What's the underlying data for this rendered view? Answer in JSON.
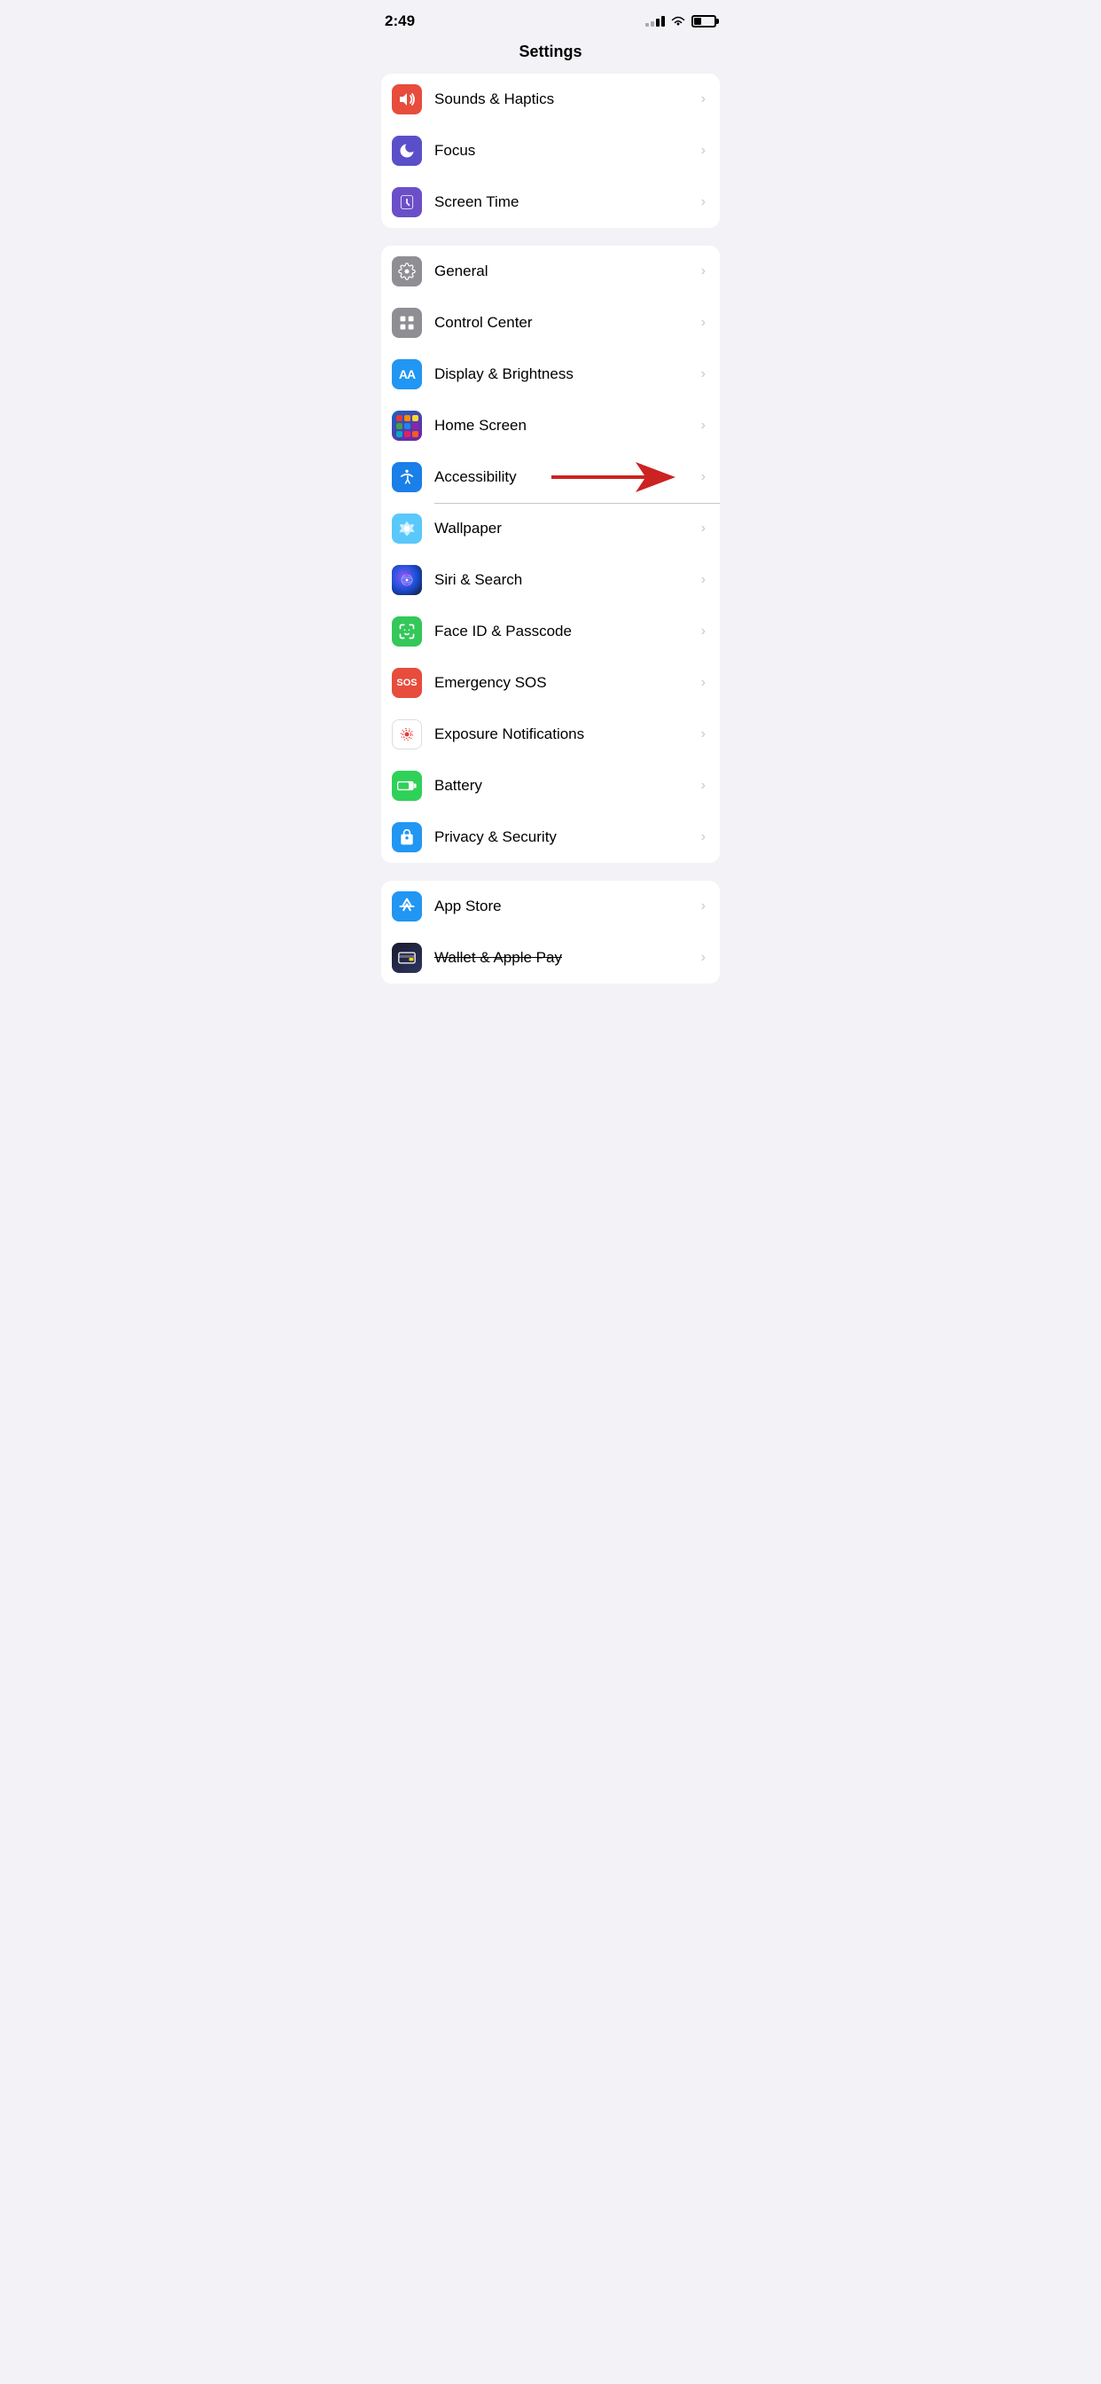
{
  "statusBar": {
    "time": "2:49"
  },
  "pageTitle": "Settings",
  "groups": [
    {
      "id": "group1",
      "items": [
        {
          "id": "sounds-haptics",
          "label": "Sounds & Haptics",
          "iconBg": "icon-red",
          "iconSymbol": "🔊"
        },
        {
          "id": "focus",
          "label": "Focus",
          "iconBg": "icon-purple",
          "iconSymbol": "🌙"
        },
        {
          "id": "screen-time",
          "label": "Screen Time",
          "iconBg": "icon-purple-dark",
          "iconSymbol": "⏱"
        }
      ]
    },
    {
      "id": "group2",
      "items": [
        {
          "id": "general",
          "label": "General",
          "iconBg": "icon-gray",
          "iconSymbol": "⚙️"
        },
        {
          "id": "control-center",
          "label": "Control Center",
          "iconBg": "icon-gray",
          "iconSymbol": "⊙"
        },
        {
          "id": "display-brightness",
          "label": "Display & Brightness",
          "iconBg": "icon-blue",
          "iconSymbol": "AA"
        },
        {
          "id": "home-screen",
          "label": "Home Screen",
          "iconBg": "icon-multicolor",
          "iconSymbol": "⠿"
        },
        {
          "id": "accessibility",
          "label": "Accessibility",
          "iconBg": "icon-blue-dark",
          "iconSymbol": "♿",
          "hasArrow": true
        },
        {
          "id": "wallpaper",
          "label": "Wallpaper",
          "iconBg": "icon-teal",
          "iconSymbol": "✿"
        },
        {
          "id": "siri-search",
          "label": "Siri & Search",
          "iconBg": "icon-siri",
          "iconSymbol": "◉"
        },
        {
          "id": "face-id",
          "label": "Face ID & Passcode",
          "iconBg": "icon-green",
          "iconSymbol": "☺"
        },
        {
          "id": "emergency-sos",
          "label": "Emergency SOS",
          "iconBg": "icon-orange-red",
          "iconSymbol": "SOS"
        },
        {
          "id": "exposure",
          "label": "Exposure Notifications",
          "iconBg": "icon-exposure",
          "iconSymbol": "◎"
        },
        {
          "id": "battery",
          "label": "Battery",
          "iconBg": "icon-battery-green",
          "iconSymbol": "▬"
        },
        {
          "id": "privacy",
          "label": "Privacy & Security",
          "iconBg": "icon-privacy",
          "iconSymbol": "✋"
        }
      ]
    },
    {
      "id": "group3",
      "items": [
        {
          "id": "app-store",
          "label": "App Store",
          "iconBg": "icon-appstore",
          "iconSymbol": "A"
        },
        {
          "id": "wallet",
          "label": "Wallet & Apple Pay",
          "iconBg": "icon-wallet",
          "iconSymbol": "💳",
          "strikethrough": true
        }
      ]
    }
  ],
  "chevron": "›",
  "arrowLabel": "accessibility-arrow"
}
